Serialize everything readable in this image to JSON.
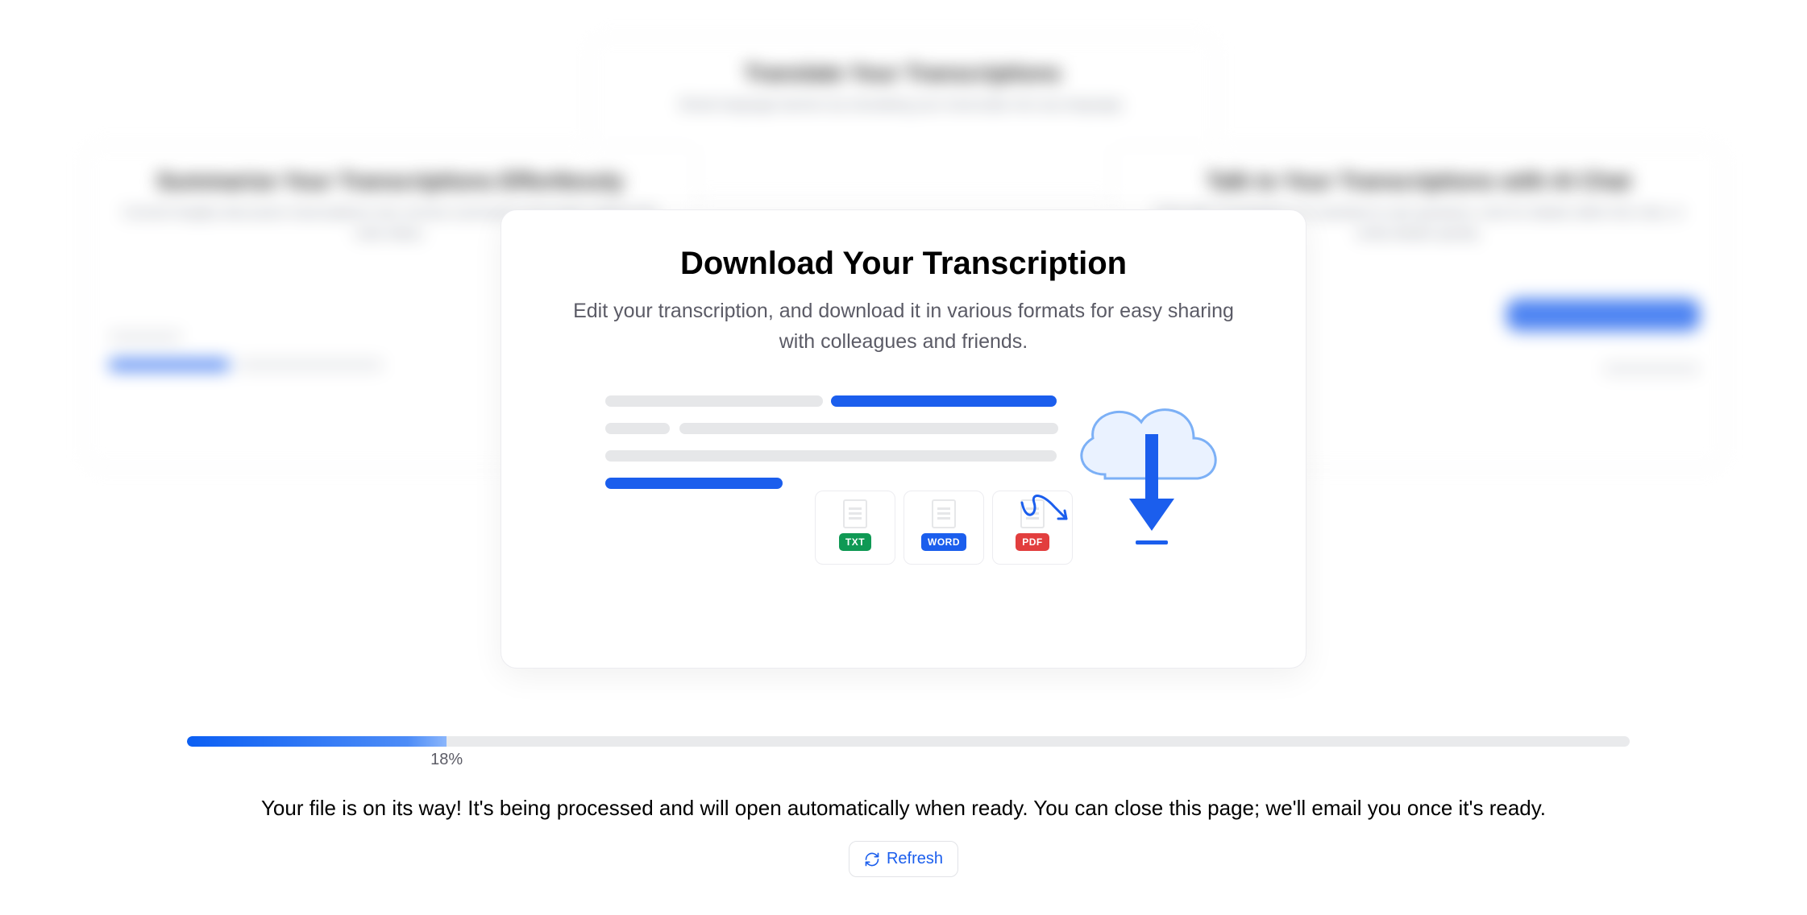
{
  "modal": {
    "title": "Download Your Transcription",
    "subtitle": "Edit your transcription, and download it in various formats for easy sharing with colleagues and friends.",
    "formats": [
      "TXT",
      "WORD",
      "PDF"
    ],
    "format_colors": {
      "TXT": "#0f9954",
      "WORD": "#1b5eed",
      "PDF": "#e23e3e"
    }
  },
  "bg_cards": {
    "left": {
      "title": "Summarize Your Transcriptions Effortlessly",
      "body": "Convert lengthy discussion transcriptions into concise summaries and easily capture the main ideas."
    },
    "top": {
      "title": "Translate Your Transcriptions",
      "body": "Break language barriers by translating your transcripts into any language."
    },
    "right": {
      "title": "Talk to Your Transcriptions with AI Chat",
      "body": "Chat with Transkriptor's AI assistant to ask questions, look for details within this chat, or verify details quickly."
    }
  },
  "progress": {
    "percent": 18,
    "label": "18%"
  },
  "status": "Your file is on its way! It's being processed and will open automatically when ready. You can close this page; we'll email you once it's ready.",
  "refresh_label": "Refresh"
}
